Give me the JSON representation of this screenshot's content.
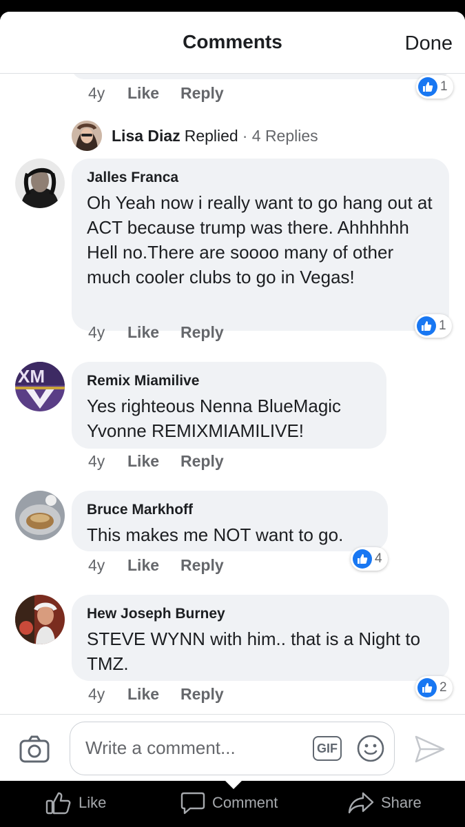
{
  "header": {
    "title": "Comments",
    "done_label": "Done"
  },
  "previous_comment": {
    "age": "4y",
    "like_label": "Like",
    "reply_label": "Reply",
    "reaction_count": "1"
  },
  "replied_row": {
    "name": "Lisa Diaz",
    "verb": "Replied",
    "count": "· 4 Replies"
  },
  "comments": [
    {
      "author": "Jalles Franca",
      "text": "Oh Yeah now i really want to go hang out at ACT because trump was there. Ahhhhhh Hell no.There are soooo many of other much cooler clubs to go in Vegas!",
      "age": "4y",
      "like_label": "Like",
      "reply_label": "Reply",
      "reaction_count": "1"
    },
    {
      "author": "Remix Miamilive",
      "text": "Yes righteous Nenna BlueMagic Yvonne REMIXMIAMILIVE!",
      "age": "4y",
      "like_label": "Like",
      "reply_label": "Reply"
    },
    {
      "author": "Bruce Markhoff",
      "text": "This makes me NOT want to go.",
      "age": "4y",
      "like_label": "Like",
      "reply_label": "Reply",
      "reaction_count": "4"
    },
    {
      "author": "Hew Joseph Burney",
      "text": "STEVE WYNN with him.. that is a Night to TMZ.",
      "age": "4y",
      "like_label": "Like",
      "reply_label": "Reply",
      "reaction_count": "2"
    }
  ],
  "composer": {
    "placeholder": "Write a comment...",
    "gif_label": "GIF"
  },
  "bottom_bar": {
    "like_label": "Like",
    "comment_label": "Comment",
    "share_label": "Share"
  },
  "colors": {
    "accent": "#1877f2",
    "bubble": "#f0f2f5",
    "muted": "#65676b"
  }
}
